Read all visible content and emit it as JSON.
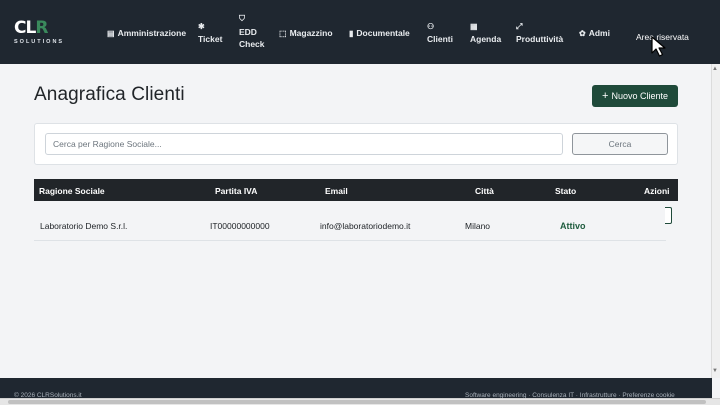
{
  "brand": {
    "logo_mark_a": "CL",
    "logo_mark_b": "R",
    "logo_sub": "SOLUTIONS"
  },
  "nav": {
    "items": [
      {
        "label": "Amministrazione",
        "icon": "document-icon"
      },
      {
        "label": "Ticket",
        "icon": "bug-icon"
      },
      {
        "label_line1": "EDD",
        "label_line2": "Check",
        "icon": "shield-icon"
      },
      {
        "label": "Magazzino",
        "icon": "box-icon"
      },
      {
        "label": "Documentale",
        "icon": "file-icon"
      },
      {
        "label": "Clienti",
        "icon": "people-icon"
      },
      {
        "label": "Agenda",
        "icon": "calendar-icon"
      },
      {
        "label": "Produttività",
        "icon": "chart-icon"
      },
      {
        "label": "Admi",
        "icon": "gear-icon"
      }
    ],
    "area_link": "Area riservata"
  },
  "page": {
    "title": "Anagrafica Clienti",
    "new_button": "Nuovo Cliente",
    "search": {
      "placeholder": "Cerca per Ragione Sociale...",
      "value": "",
      "button": "Cerca"
    }
  },
  "table": {
    "headers": [
      "Ragione Sociale",
      "Partita IVA",
      "Email",
      "Città",
      "Stato",
      "Azioni"
    ],
    "rows": [
      {
        "ragione_sociale": "Laboratorio Demo S.r.l.",
        "partita_iva": "IT00000000000",
        "email": "info@laboratoriodemo.it",
        "citta": "Milano",
        "stato": "Attivo"
      }
    ]
  },
  "footer": {
    "left": "© 2026 CLRSolutions.it",
    "right": "Software engineering · Consulenza IT · Infrastrutture · Preferenze cookie"
  },
  "colors": {
    "navbar": "#1f2730",
    "primary": "#1f4a3a",
    "status_active": "#1e5c3e",
    "table_head": "#212529"
  }
}
